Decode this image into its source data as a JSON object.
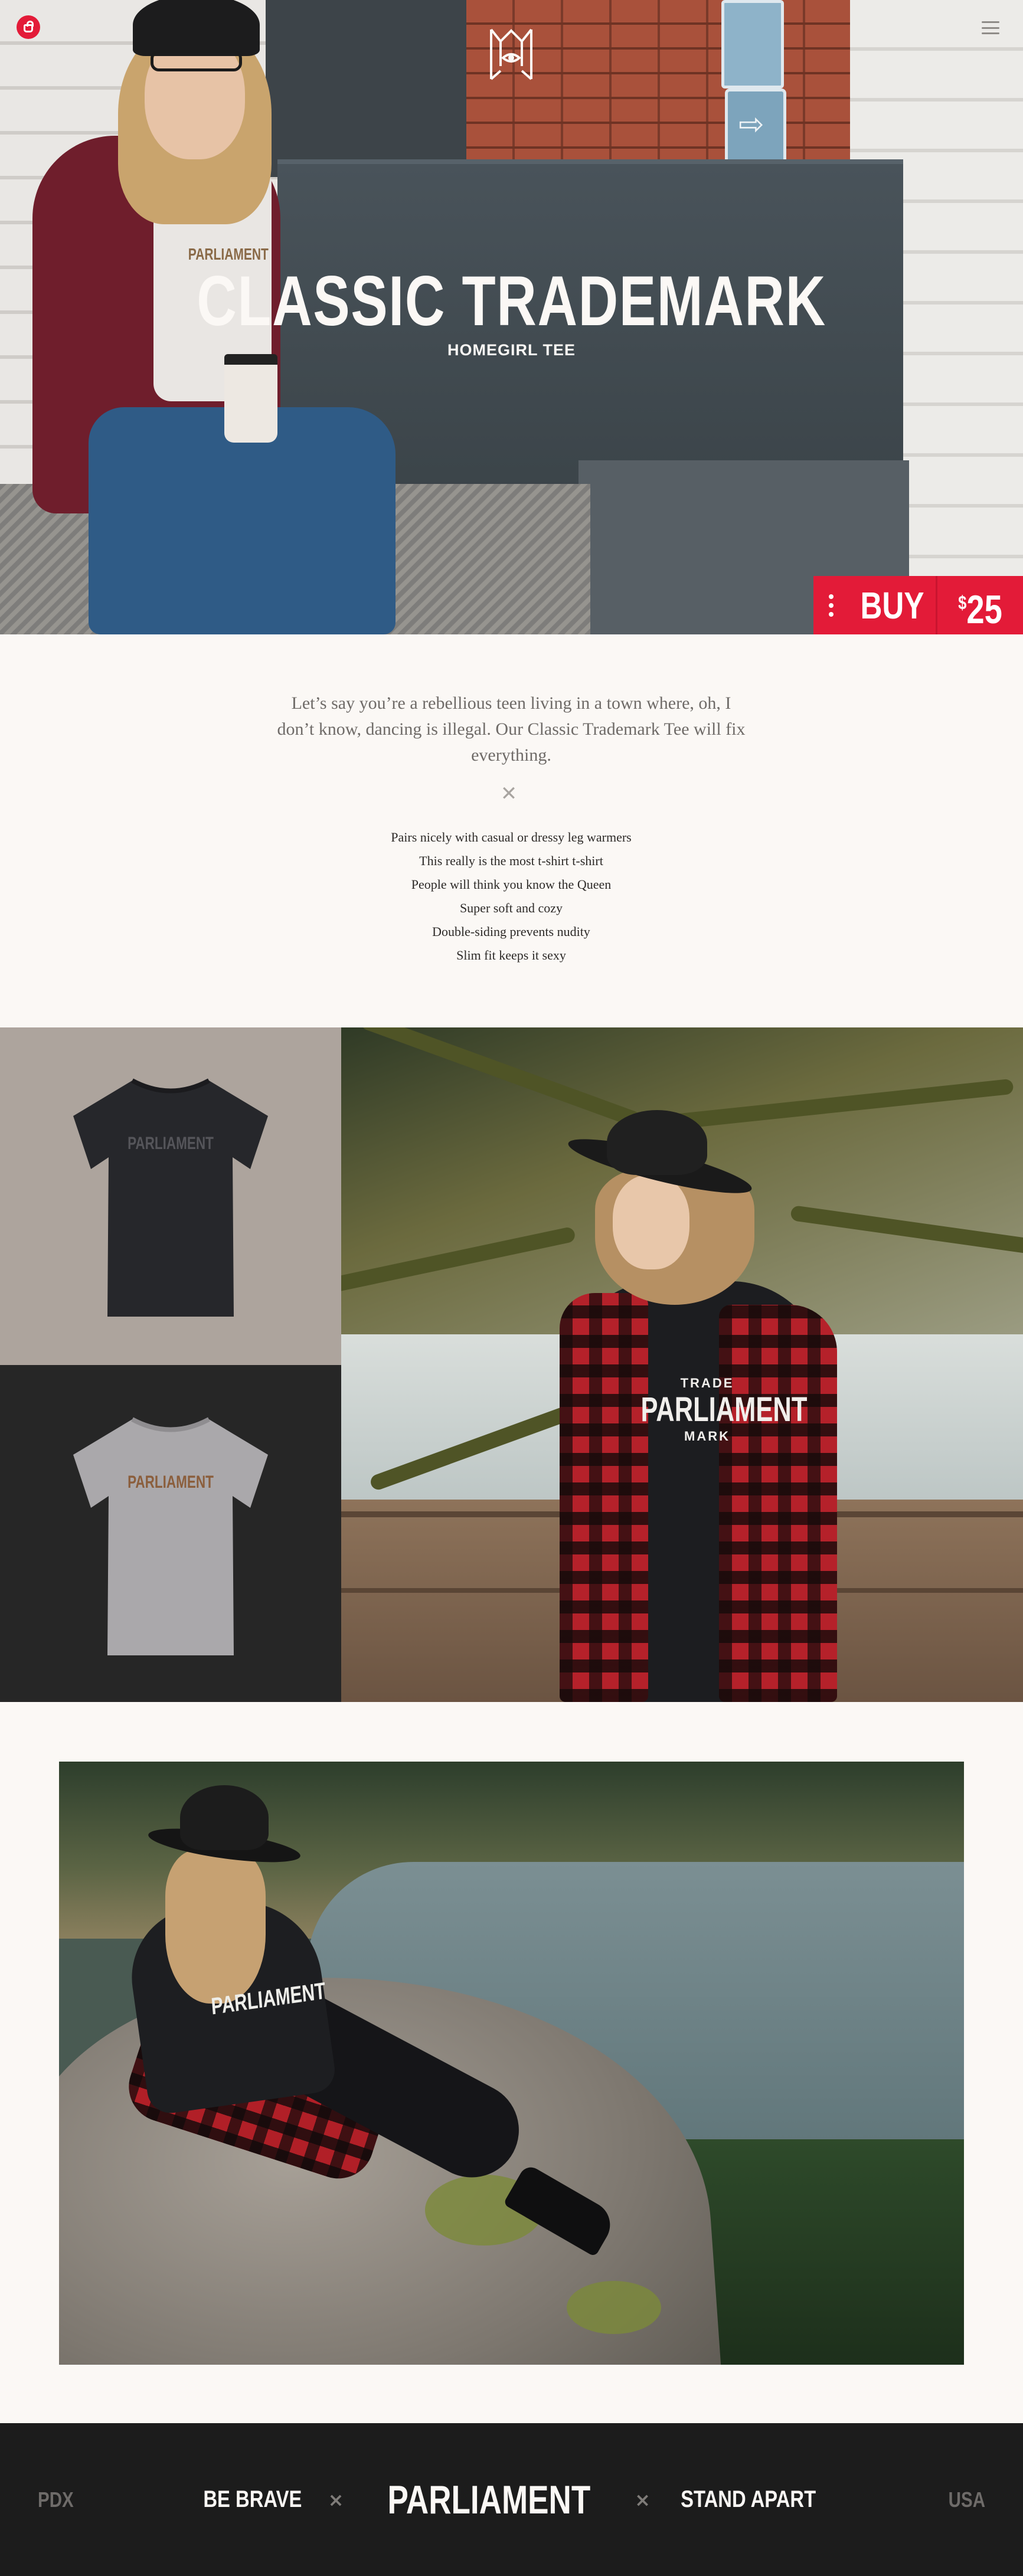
{
  "header": {
    "cart_icon": "shopping-bag-icon",
    "logo_icon": "parliament-crest-icon",
    "menu_icon": "hamburger-menu-icon"
  },
  "hero": {
    "title": "CLASSIC TRADEMARK",
    "subtitle": "HOMEGIRL TEE",
    "shirt_print": "PARLIAMENT"
  },
  "buy_bar": {
    "options_icon": "vertical-dots-icon",
    "label": "BUY",
    "currency": "$",
    "price": "25"
  },
  "description": {
    "intro": "Let’s say you’re a rebellious teen living in a town where, oh, I don’t know, dancing is illegal. Our Classic Trademark Tee will fix everything.",
    "divider_icon": "cross-divider-icon",
    "features": [
      "Pairs nicely with casual or dressy leg warmers",
      "This really is the most t-shirt t-shirt",
      "People will think you know the Queen",
      "Super soft and cozy",
      "Double-siding prevents nudity",
      "Slim fit keeps it sexy"
    ]
  },
  "gallery": {
    "tee_dark_print": "PARLIAMENT",
    "tee_grey_print": "PARLIAMENT",
    "model_print_top": "TRADE",
    "model_print_main": "PARLIAMENT",
    "model_print_bottom": "MARK",
    "lake_print": "PARLIAMENT"
  },
  "footer": {
    "left": "PDX",
    "slogan_left": "BE BRAVE",
    "brand": "PARLIAMENT",
    "slogan_right": "STAND APART",
    "right": "USA",
    "separator": "×"
  },
  "colors": {
    "accent": "#e31b38",
    "background": "#fbf8f5",
    "footer_bg": "#1c1c1c",
    "body_text": "#2d2a28"
  }
}
